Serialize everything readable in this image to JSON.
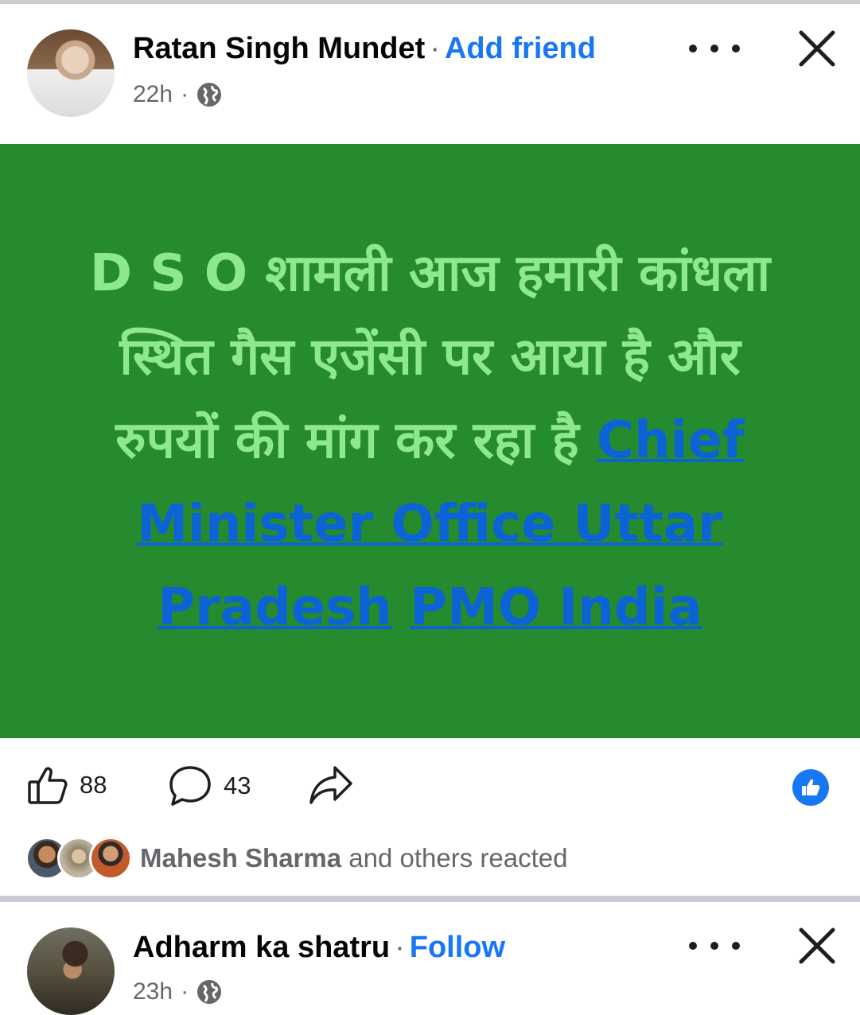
{
  "posts": [
    {
      "author": "Ratan Singh Mundet",
      "action": "Add friend",
      "time": "22h",
      "body": {
        "text": "D S O शामली आज हमारी कांधला स्थित गैस एजेंसी पर आया है और रुपयों की मांग कर रहा है",
        "mention_1": "Chief Minister Office Uttar Pradesh",
        "mention_2": "PMO India",
        "background_color": "#268a2e",
        "text_color": "#8ee88f"
      },
      "likes": "88",
      "comments": "43",
      "reacted_name": "Mahesh Sharma",
      "reacted_suffix": "and others reacted"
    },
    {
      "author": "Adharm ka shatru",
      "action": "Follow",
      "time": "23h"
    }
  ],
  "colors": {
    "accent": "#1877f2",
    "muted": "#65676b"
  },
  "icons": [
    "globe-icon",
    "more-icon",
    "close-icon",
    "like-icon",
    "comment-icon",
    "share-icon",
    "like-reaction-icon"
  ]
}
